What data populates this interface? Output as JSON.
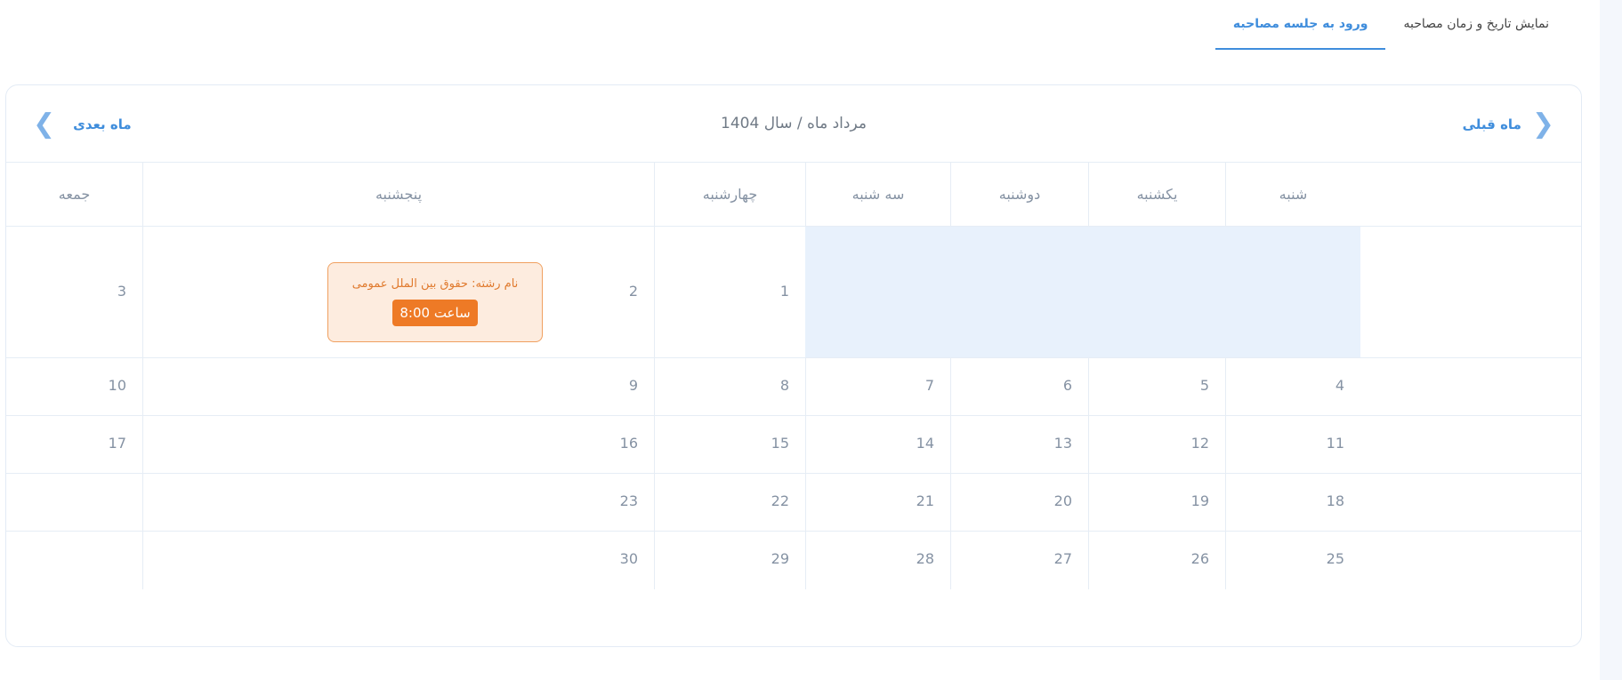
{
  "tabs": {
    "show_schedule": "نمایش تاریخ و زمان مصاحبه",
    "enter_session": "ورود به جلسه مصاحبه"
  },
  "calendar": {
    "prev_label": "ماه قبلی",
    "next_label": "ماه بعدی",
    "month_title": "مرداد ماه / سال 1404",
    "day_names": {
      "sat": "شنبه",
      "sun": "یکشنبه",
      "mon": "دوشنبه",
      "tue": "سه شنبه",
      "wed": "چهارشنبه",
      "thu": "پنجشنبه",
      "fri": "جمعه"
    },
    "weeks": [
      [
        "",
        "",
        "",
        "",
        "1",
        "2",
        "3"
      ],
      [
        "4",
        "5",
        "6",
        "7",
        "8",
        "9",
        "10"
      ],
      [
        "11",
        "12",
        "13",
        "14",
        "15",
        "16",
        "17"
      ],
      [
        "18",
        "19",
        "20",
        "21",
        "22",
        "23",
        ""
      ],
      [
        "25",
        "26",
        "27",
        "28",
        "29",
        "30",
        ""
      ]
    ],
    "event": {
      "title": "نام رشته: حقوق بین الملل عمومی",
      "time": "ساعت 8:00"
    }
  },
  "colors": {
    "accent": "#3f8ddc",
    "event_bg": "#fdecdf",
    "event_badge": "#ee7a26",
    "empty_cell": "#e8f1fc"
  }
}
